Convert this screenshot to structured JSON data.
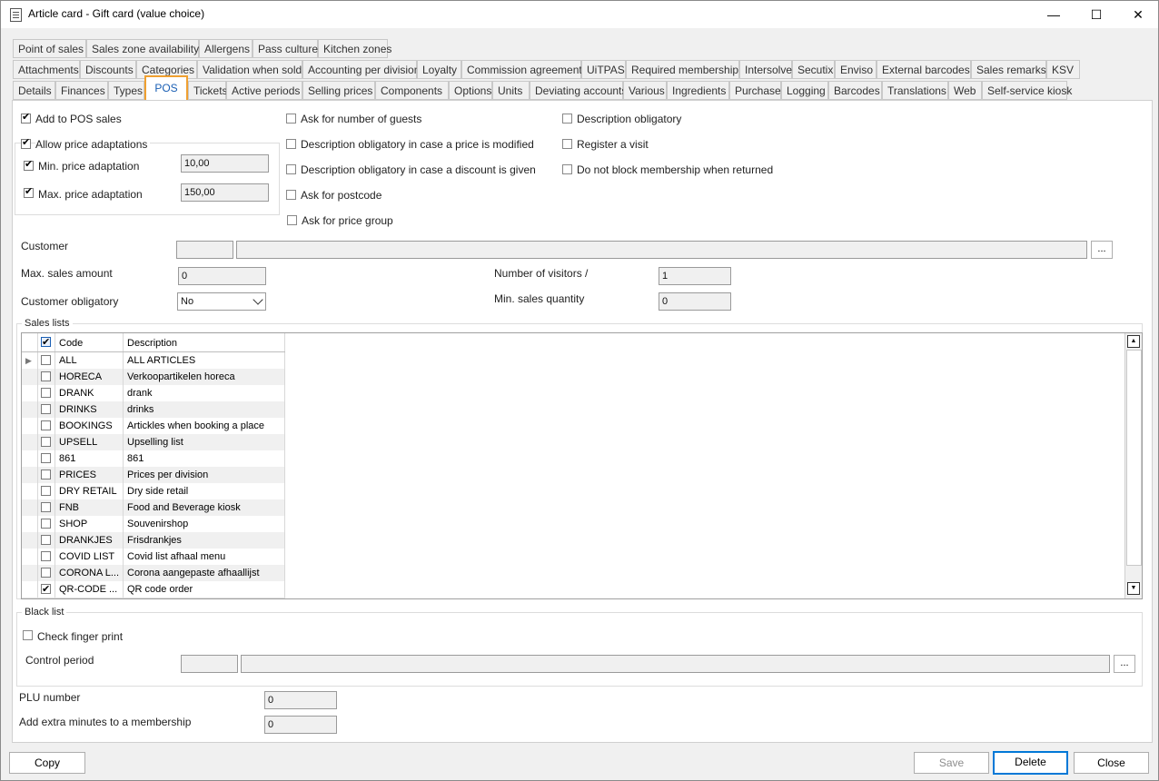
{
  "window": {
    "title": "Article card - Gift card (value choice)",
    "minimize": "—",
    "maximize": "☐",
    "close": "✕"
  },
  "tabs": {
    "row1": [
      "Point of sales",
      "Sales zone availability",
      "Allergens",
      "Pass culture",
      "Kitchen zones"
    ],
    "row2": [
      "Attachments",
      "Discounts",
      "Categories",
      "Validation when sold",
      "Accounting per division",
      "Loyalty",
      "Commission agreement",
      "UiTPAS",
      "Required membership",
      "Intersolve",
      "Secutix",
      "Enviso",
      "External barcodes",
      "Sales remarks",
      "KSV"
    ],
    "row3": [
      "Details",
      "Finances",
      "Types",
      "POS",
      "Tickets",
      "Active periods",
      "Selling prices",
      "Components",
      "Options",
      "Units",
      "Deviating accounts",
      "Various",
      "Ingredients",
      "Purchase",
      "Logging",
      "Barcodes",
      "Translations",
      "Web",
      "Self-service kiosk"
    ],
    "active": "POS"
  },
  "pos": {
    "add_to_pos": "Add to POS sales",
    "allow_price": "Allow price adaptations",
    "min_price_label": "Min. price adaptation",
    "min_price_value": "10,00",
    "max_price_label": "Max. price adaptation",
    "max_price_value": "150,00",
    "ask_guests": "Ask for number of guests",
    "desc_price_modified": "Description obligatory in case a price is modified",
    "desc_discount": "Description obligatory in case a discount is given",
    "ask_postcode": "Ask for postcode",
    "ask_price_group": "Ask for price group",
    "desc_obligatory": "Description obligatory",
    "register_visit": "Register a visit",
    "no_block_membership": "Do not block membership when returned",
    "customer_label": "Customer",
    "customer_code": "",
    "customer_name": "",
    "dots": "...",
    "max_sales_label": "Max. sales amount",
    "max_sales_value": "0",
    "visitors_label": "Number of visitors /",
    "visitors_value": "1",
    "customer_obligatory_label": "Customer obligatory",
    "customer_obligatory_value": "No",
    "min_qty_label": "Min. sales quantity",
    "min_qty_value": "0"
  },
  "sales_lists": {
    "title": "Sales lists",
    "col_code": "Code",
    "col_desc": "Description",
    "rows": [
      {
        "code": "ALL",
        "desc": "ALL ARTICLES",
        "checked": false
      },
      {
        "code": "HORECA",
        "desc": "Verkoopartikelen horeca",
        "checked": false
      },
      {
        "code": "DRANK",
        "desc": "drank",
        "checked": false
      },
      {
        "code": "DRINKS",
        "desc": "drinks",
        "checked": false
      },
      {
        "code": "BOOKINGS",
        "desc": "Artickles when booking a place",
        "checked": false
      },
      {
        "code": "UPSELL",
        "desc": "Upselling list",
        "checked": false
      },
      {
        "code": "861",
        "desc": "861",
        "checked": false
      },
      {
        "code": "PRICES",
        "desc": "Prices per division",
        "checked": false
      },
      {
        "code": "DRY RETAIL",
        "desc": "Dry side retail",
        "checked": false
      },
      {
        "code": "FNB",
        "desc": "Food and Beverage kiosk",
        "checked": false
      },
      {
        "code": "SHOP",
        "desc": "Souvenirshop",
        "checked": false
      },
      {
        "code": "DRANKJES",
        "desc": "Frisdrankjes",
        "checked": false
      },
      {
        "code": "COVID LIST",
        "desc": "Covid list afhaal menu",
        "checked": false
      },
      {
        "code": "CORONA L...",
        "desc": "Corona aangepaste afhaallijst",
        "checked": false
      },
      {
        "code": "QR-CODE ...",
        "desc": "QR code order",
        "checked": true
      }
    ]
  },
  "black_list": {
    "title": "Black list",
    "check_finger": "Check finger print",
    "control_period_label": "Control period",
    "dots": "..."
  },
  "plu_label": "PLU number",
  "plu_value": "0",
  "extra_minutes_label": "Add extra minutes to a membership",
  "extra_minutes_value": "0",
  "buttons": {
    "copy": "Copy",
    "save": "Save",
    "delete": "Delete",
    "close": "Close"
  }
}
